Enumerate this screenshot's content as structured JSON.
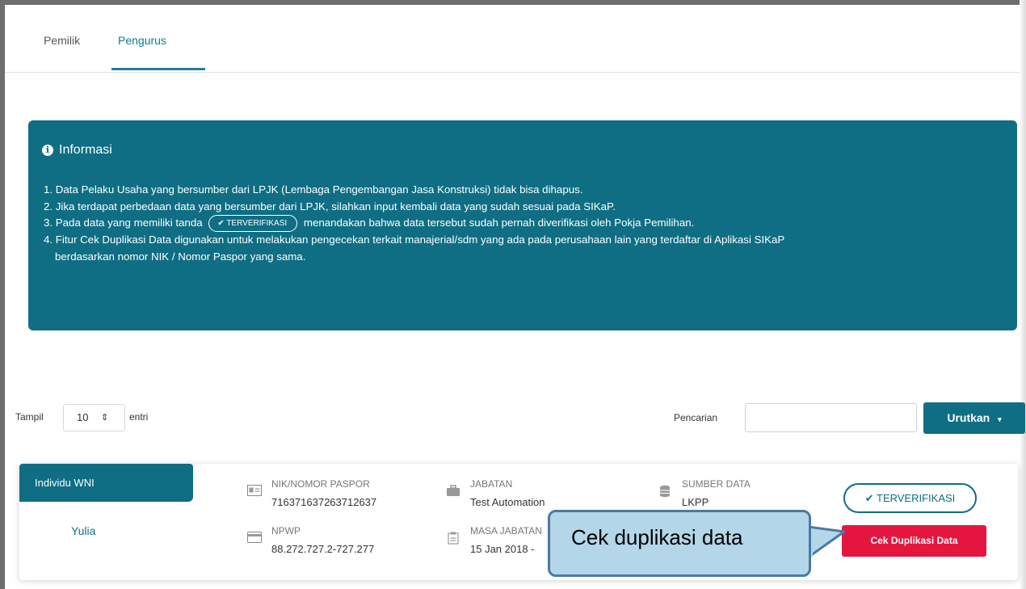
{
  "tabs": {
    "pemilik": "Pemilik",
    "pengurus": "Pengurus"
  },
  "info": {
    "title": "Informasi",
    "item1": "1. Data Pelaku Usaha yang bersumber dari LPJK (Lembaga Pengembangan Jasa Konstruksi) tidak bisa dihapus.",
    "item2": "2. Jika terdapat perbedaan data yang bersumber dari LPJK, silahkan input kembali data yang sudah sesuai pada SIKaP.",
    "item3_before": "3. Pada data yang memiliki tanda",
    "item3_badge": "TERVERIFIKASI",
    "item3_after": "menandakan bahwa data tersebut sudah pernah diverifikasi oleh Pokja Pemilihan.",
    "item4_line1": "4. Fitur Cek Duplikasi Data digunakan untuk melakukan pengecekan terkait manajerial/sdm yang ada pada perusahaan lain yang terdaftar di Aplikasi SIKaP",
    "item4_line2": "berdasarkan nomor NIK / Nomor Paspor yang sama."
  },
  "controls": {
    "tampil": "Tampil",
    "entries_value": "10",
    "entri": "entri",
    "pencarian": "Pencarian",
    "search_value": "",
    "sort_button": "Urutkan"
  },
  "record": {
    "category": "Individu WNI",
    "name": "Yulia",
    "nik_label": "NIK/NOMOR PASPOR",
    "nik_value": "716371637263712637",
    "npwp_label": "NPWP",
    "npwp_value": "88.272.727.2-727.277",
    "jabatan_label": "JABATAN",
    "jabatan_value": "Test Automation",
    "masa_label": "MASA JABATAN",
    "masa_value": "15 Jan 2018 - ",
    "sumber_label": "SUMBER DATA",
    "sumber_value": "LKPP",
    "verified_button": "TERVERIFIKASI",
    "cek_button": "Cek Duplikasi Data"
  },
  "callout": {
    "text": "Cek duplikasi data"
  },
  "colors": {
    "primary": "#0f6e84",
    "danger": "#e4163f",
    "callout_fill": "#b3d6e8",
    "callout_border": "#4c79a6"
  }
}
